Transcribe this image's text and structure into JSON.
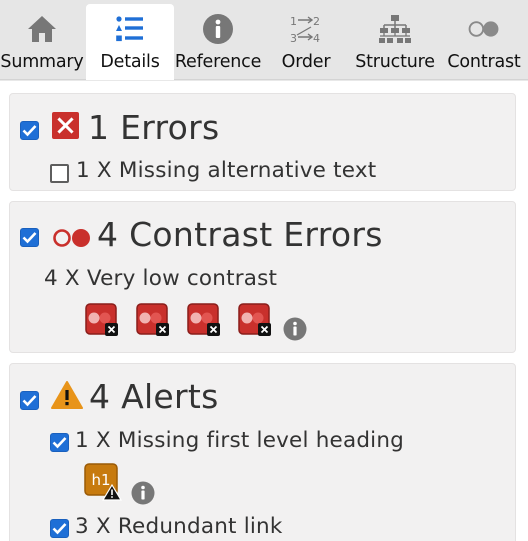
{
  "tabs": [
    {
      "label": "Summary",
      "icon": "home-icon"
    },
    {
      "label": "Details",
      "icon": "list-icon",
      "active": true
    },
    {
      "label": "Reference",
      "icon": "info-icon"
    },
    {
      "label": "Order",
      "icon": "order-icon"
    },
    {
      "label": "Structure",
      "icon": "structure-icon"
    },
    {
      "label": "Contrast",
      "icon": "contrast-icon"
    }
  ],
  "sections": {
    "errors": {
      "heading": "1 Errors",
      "checked": true,
      "items": [
        {
          "label": "1 X Missing alternative text",
          "checked": false
        }
      ]
    },
    "contrast": {
      "heading": "4 Contrast Errors",
      "checked": true,
      "items": [
        {
          "label": "4 X Very low contrast",
          "count": 4
        }
      ]
    },
    "alerts": {
      "heading": "4 Alerts",
      "checked": true,
      "items": [
        {
          "label": "1 X Missing first level heading",
          "checked": true,
          "badge": "h1"
        },
        {
          "label": "3 X Redundant link",
          "checked": true
        }
      ]
    }
  },
  "colors": {
    "checkbox": "#1f6fd6",
    "error_red": "#c9302c",
    "alert_orange": "#e8941a",
    "tab_icon_gray": "#777777"
  }
}
